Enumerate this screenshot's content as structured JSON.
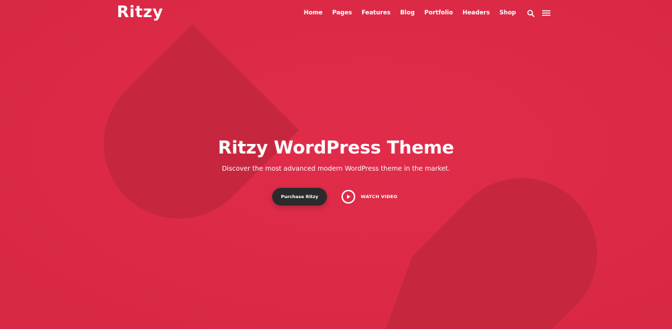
{
  "brand": {
    "logo_text": "Ritzy",
    "background_color": "#dc2a47",
    "shape_color": "#c4273e",
    "button_color": "#2b2b2c",
    "text_color": "#ffffff"
  },
  "nav": {
    "items": [
      {
        "label": "Home"
      },
      {
        "label": "Pages"
      },
      {
        "label": "Features"
      },
      {
        "label": "Blog"
      },
      {
        "label": "Portfolio"
      },
      {
        "label": "Headers"
      },
      {
        "label": "Shop"
      }
    ],
    "icons": [
      "search-icon",
      "menu-icon"
    ]
  },
  "hero": {
    "title": "Ritzy WordPress Theme",
    "subtitle": "Discover the most advanced modern WordPress theme in the market.",
    "primary_button": "Purchase Ritzy",
    "video_link": "WATCH VIDEO",
    "video_icon": "play-icon"
  }
}
